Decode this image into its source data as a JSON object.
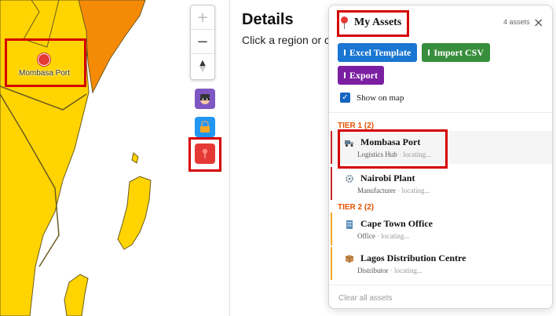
{
  "map": {
    "marker_label": "Mombasa Port",
    "colors": {
      "land_yellow": "#ffd400",
      "land_orange": "#f58a07",
      "border": "#6b5a20"
    },
    "controls": {
      "zoom_in": "+",
      "zoom_out": "−",
      "compass_up": "▲",
      "compass_down": "▼"
    },
    "tools": [
      {
        "name": "robber-mask-icon"
      },
      {
        "name": "lock-icon"
      },
      {
        "name": "pin-icon"
      }
    ]
  },
  "details": {
    "title": "Details",
    "subtitle": "Click a region or c"
  },
  "assets_panel": {
    "title": "My Assets",
    "count": "4 assets",
    "close": "×",
    "buttons": {
      "excel": "Excel Template",
      "import": "Import CSV",
      "export": "Export"
    },
    "show_on_map": "Show on map",
    "show_on_map_checked": true,
    "tiers": [
      {
        "label": "TIER 1 (2)",
        "items": [
          {
            "name": "Mombasa Port",
            "type": "Logistics Hub",
            "status": "locating...",
            "icon": "truck-icon"
          },
          {
            "name": "Nairobi Plant",
            "type": "Manufacturer",
            "status": "locating...",
            "icon": "gear-icon"
          }
        ]
      },
      {
        "label": "TIER 2 (2)",
        "items": [
          {
            "name": "Cape Town Office",
            "type": "Office",
            "status": "locating...",
            "icon": "building-icon"
          },
          {
            "name": "Lagos Distribution Centre",
            "type": "Distributor",
            "status": "locating...",
            "icon": "box-icon"
          }
        ]
      }
    ],
    "clear_all": "Clear all assets",
    "meta_separator": " · "
  }
}
